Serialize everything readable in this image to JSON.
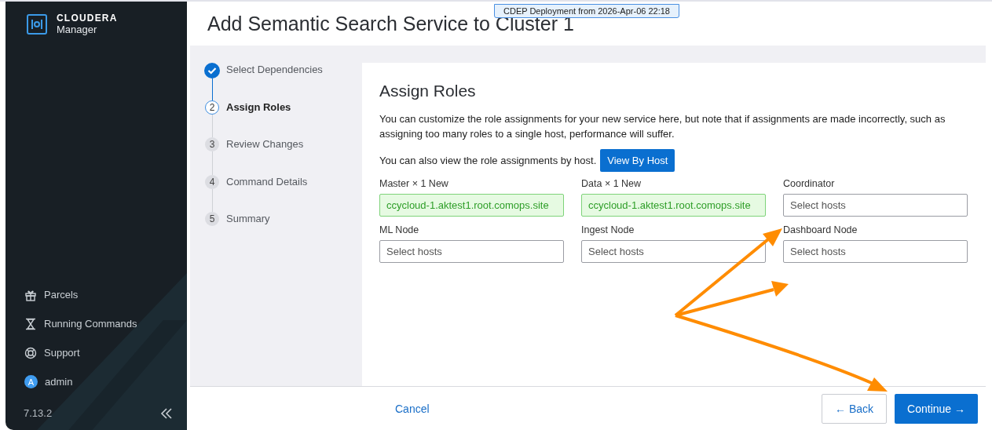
{
  "sidebar": {
    "brand": "CLOUDERA",
    "product": "Manager",
    "items": [
      {
        "label": "Parcels",
        "kind": "gift"
      },
      {
        "label": "Running Commands",
        "kind": "hourglass"
      },
      {
        "label": "Support",
        "kind": "lifebuoy"
      },
      {
        "label": "admin",
        "kind": "avatar",
        "avatar_letter": "A"
      }
    ],
    "version": "7.13.2"
  },
  "deployment_badge": "CDEP Deployment from 2026-Apr-06 22:18",
  "page_title": "Add Semantic Search Service to Cluster 1",
  "steps": [
    {
      "label": "Select Dependencies",
      "kind": "completed",
      "selected": false
    },
    {
      "number": "2",
      "label": "Assign Roles",
      "kind": "numbered",
      "selected": true
    },
    {
      "number": "3",
      "label": "Review Changes",
      "kind": "numbered",
      "selected": false
    },
    {
      "number": "4",
      "label": "Command Details",
      "kind": "numbered",
      "selected": false
    },
    {
      "number": "5",
      "label": "Summary",
      "kind": "numbered",
      "selected": false
    }
  ],
  "panel": {
    "heading": "Assign Roles",
    "description": "You can customize the role assignments for your new service here, but note that if assignments are made incorrectly, such as assigning too many roles to a single host, performance will suffer.",
    "view_by_host_text": "You can also view the role assignments by host.",
    "view_by_host_button": "View By Host",
    "roles": [
      {
        "label": "Master × 1 New",
        "kind": "assigned",
        "value": "ccycloud-1.aktest1.root.comops.site"
      },
      {
        "label": "Data × 1 New",
        "kind": "assigned",
        "value": "ccycloud-1.aktest1.root.comops.site"
      },
      {
        "label": "Coordinator",
        "kind": "empty",
        "placeholder": "Select hosts"
      },
      {
        "label": "ML Node",
        "kind": "empty",
        "placeholder": "Select hosts"
      },
      {
        "label": "Ingest Node",
        "kind": "empty",
        "placeholder": "Select hosts"
      },
      {
        "label": "Dashboard Node",
        "kind": "empty",
        "placeholder": "Select hosts"
      }
    ]
  },
  "footer": {
    "cancel": "Cancel",
    "back": "← Back",
    "continue": "Continue →"
  }
}
